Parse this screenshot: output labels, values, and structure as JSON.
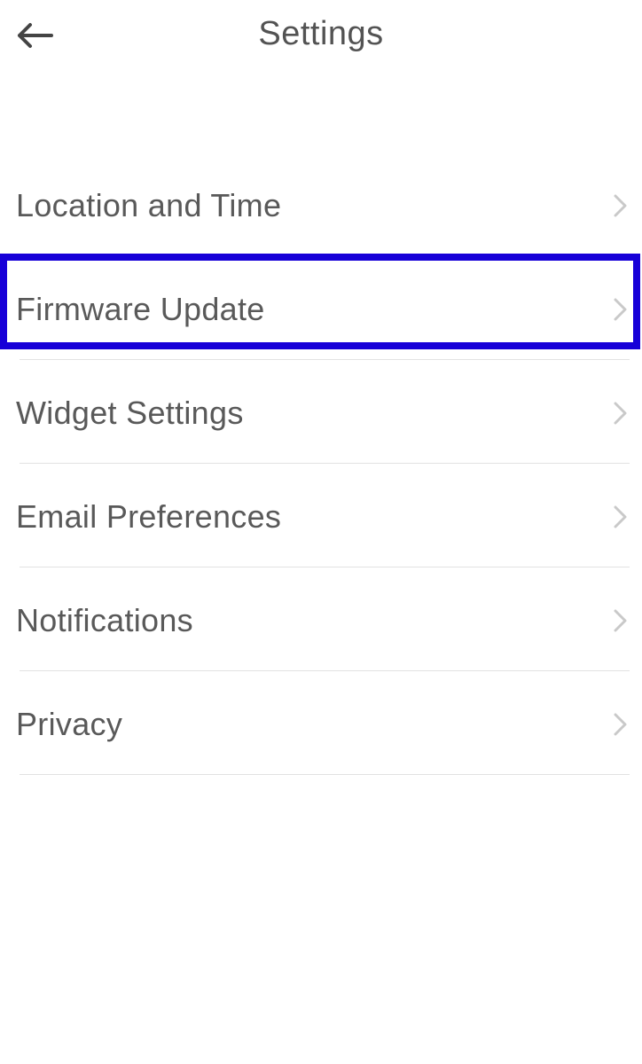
{
  "header": {
    "title": "Settings"
  },
  "settings": {
    "items": [
      {
        "label": "Location and Time"
      },
      {
        "label": "Firmware Update"
      },
      {
        "label": "Widget Settings"
      },
      {
        "label": "Email Preferences"
      },
      {
        "label": "Notifications"
      },
      {
        "label": "Privacy"
      }
    ]
  }
}
